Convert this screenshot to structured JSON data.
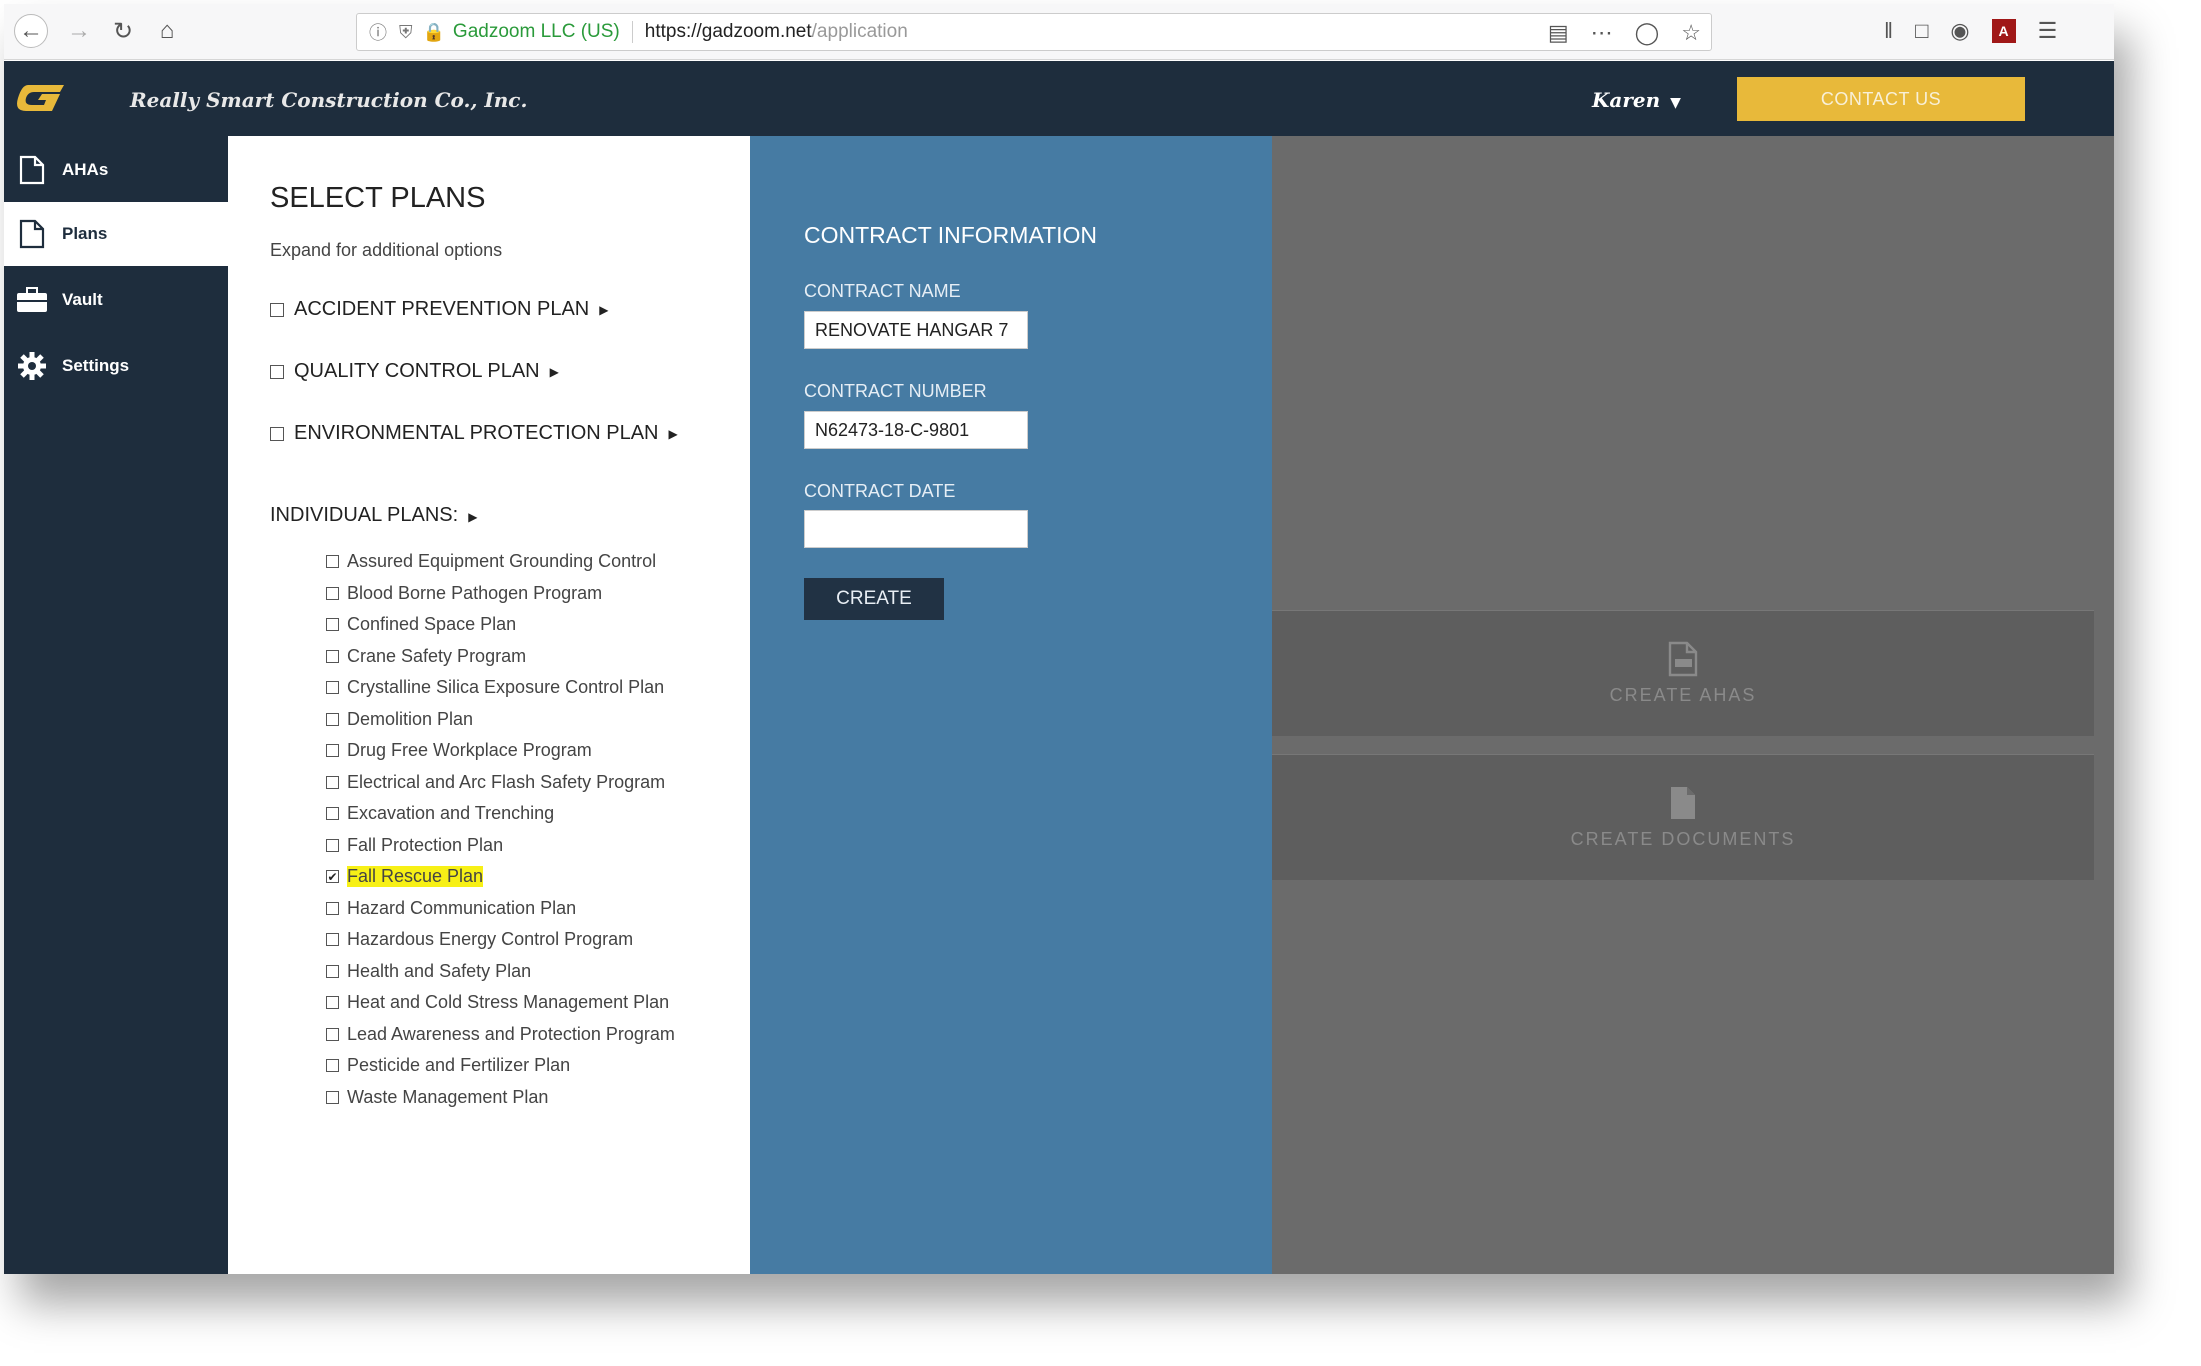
{
  "browser": {
    "site_identity": "Gadzoom LLC (US)",
    "url_host": "https://gadzoom.net",
    "url_path": "/application"
  },
  "header": {
    "company": "Really Smart Construction Co., Inc.",
    "user": "Karen",
    "contact_label": "CONTACT US"
  },
  "sidebar": {
    "items": [
      {
        "label": "AHAs",
        "icon": "document-icon"
      },
      {
        "label": "Plans",
        "icon": "document-icon"
      },
      {
        "label": "Vault",
        "icon": "briefcase-icon"
      },
      {
        "label": "Settings",
        "icon": "gear-icon"
      }
    ],
    "active": "Plans"
  },
  "plans": {
    "title": "SELECT PLANS",
    "subtitle": "Expand for additional options",
    "main": [
      "ACCIDENT PREVENTION PLAN",
      "QUALITY CONTROL PLAN",
      "ENVIRONMENTAL PROTECTION PLAN"
    ],
    "individual_heading": "INDIVIDUAL PLANS:",
    "individual": [
      {
        "label": "Assured Equipment Grounding Control",
        "checked": false
      },
      {
        "label": "Blood Borne Pathogen Program",
        "checked": false
      },
      {
        "label": "Confined Space Plan",
        "checked": false
      },
      {
        "label": "Crane Safety Program",
        "checked": false
      },
      {
        "label": "Crystalline Silica Exposure Control Plan",
        "checked": false
      },
      {
        "label": "Demolition Plan",
        "checked": false
      },
      {
        "label": "Drug Free Workplace Program",
        "checked": false
      },
      {
        "label": "Electrical and Arc Flash Safety Program",
        "checked": false
      },
      {
        "label": "Excavation and Trenching",
        "checked": false
      },
      {
        "label": "Fall Protection Plan",
        "checked": false
      },
      {
        "label": "Fall Rescue Plan",
        "checked": true
      },
      {
        "label": "Hazard Communication Plan",
        "checked": false
      },
      {
        "label": "Hazardous Energy Control Program",
        "checked": false
      },
      {
        "label": "Health and Safety Plan",
        "checked": false
      },
      {
        "label": "Heat and Cold Stress Management Plan",
        "checked": false
      },
      {
        "label": "Lead Awareness and Protection Program",
        "checked": false
      },
      {
        "label": "Pesticide and Fertilizer Plan",
        "checked": false
      },
      {
        "label": "Waste Management Plan",
        "checked": false
      }
    ]
  },
  "contract": {
    "title": "CONTRACT INFORMATION",
    "name_label": "CONTRACT NAME",
    "name_value": "RENOVATE HANGAR 7",
    "number_label": "CONTRACT NUMBER",
    "number_value": "N62473-18-C-9801",
    "date_label": "CONTRACT DATE",
    "date_value": "",
    "create_label": "CREATE"
  },
  "actions": {
    "create_ahas": "CREATE AHAS",
    "create_documents": "CREATE DOCUMENTS"
  },
  "colors": {
    "nav_dark": "#1e2d3d",
    "contract_blue": "#467ba3",
    "accent_gold": "#e8b93a",
    "highlight": "#f7f016"
  }
}
